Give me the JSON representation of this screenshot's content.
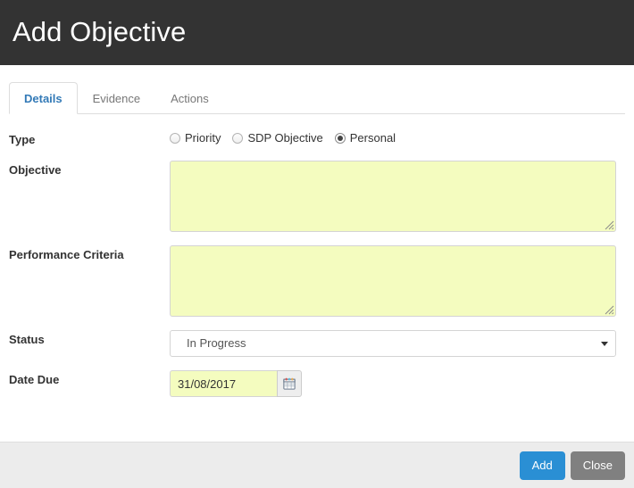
{
  "header": {
    "title": "Add Objective"
  },
  "tabs": [
    {
      "label": "Details",
      "active": true
    },
    {
      "label": "Evidence",
      "active": false
    },
    {
      "label": "Actions",
      "active": false
    }
  ],
  "form": {
    "type": {
      "label": "Type",
      "options": [
        {
          "label": "Priority",
          "selected": false
        },
        {
          "label": "SDP Objective",
          "selected": false
        },
        {
          "label": "Personal",
          "selected": true
        }
      ]
    },
    "objective": {
      "label": "Objective",
      "value": "",
      "placeholder": ""
    },
    "performance_criteria": {
      "label": "Performance Criteria",
      "value": "",
      "placeholder": ""
    },
    "status": {
      "label": "Status",
      "value": "In Progress",
      "options": [
        "In Progress"
      ]
    },
    "date_due": {
      "label": "Date Due",
      "value": "31/08/2017",
      "placeholder": "",
      "picker_icon": "calendar-icon"
    }
  },
  "footer": {
    "add_label": "Add",
    "close_label": "Close"
  },
  "colors": {
    "header_bg": "#333333",
    "accent_tab": "#337ab7",
    "field_yellow": "#f4fcbf",
    "primary_button": "#2a8fd4",
    "default_button": "#808080",
    "footer_bg": "#ececec"
  }
}
